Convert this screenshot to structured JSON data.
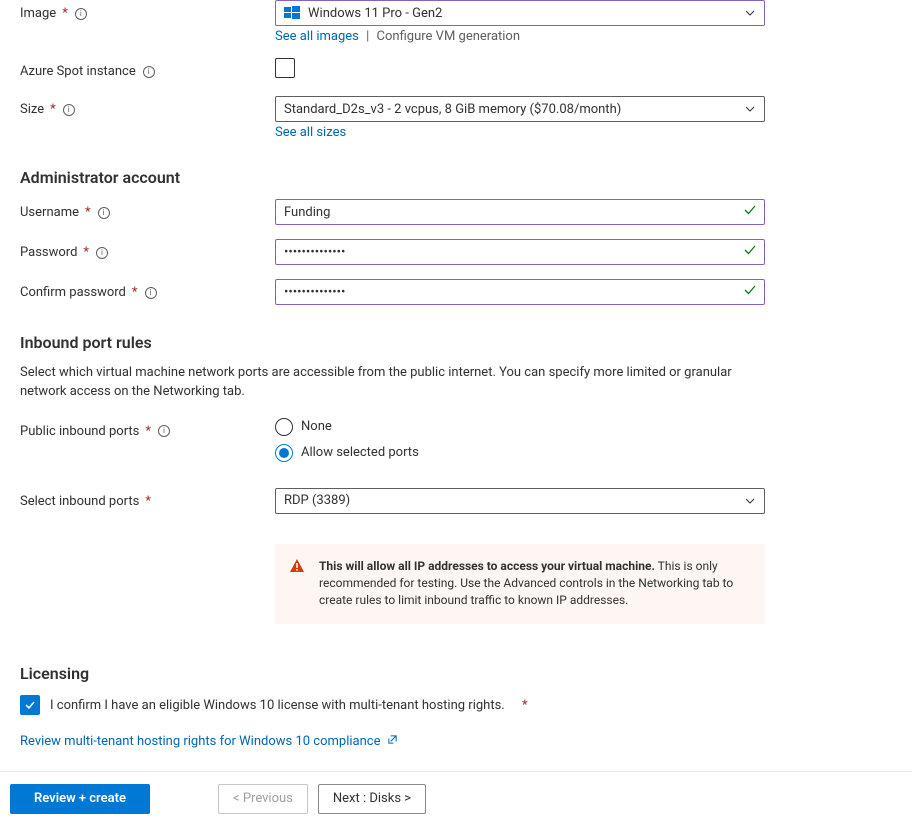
{
  "image": {
    "label": "Image",
    "value": "Windows 11 Pro - Gen2",
    "see_all": "See all images",
    "configure": "Configure VM generation"
  },
  "spot": {
    "label": "Azure Spot instance",
    "checked": false
  },
  "size": {
    "label": "Size",
    "value": "Standard_D2s_v3 - 2 vcpus, 8 GiB memory ($70.08/month)",
    "see_all": "See all sizes"
  },
  "admin": {
    "heading": "Administrator account",
    "username_label": "Username",
    "username_value": "Funding",
    "password_label": "Password",
    "password_value": "••••••••••••••",
    "confirm_label": "Confirm password",
    "confirm_value": "••••••••••••••"
  },
  "inbound": {
    "heading": "Inbound port rules",
    "desc": "Select which virtual machine network ports are accessible from the public internet. You can specify more limited or granular network access on the Networking tab.",
    "public_label": "Public inbound ports",
    "option_none": "None",
    "option_allow": "Allow selected ports",
    "select_label": "Select inbound ports",
    "select_value": "RDP (3389)",
    "warning_strong": "This will allow all IP addresses to access your virtual machine.",
    "warning_rest": " This is only recommended for testing.  Use the Advanced controls in the Networking tab to create rules to limit inbound traffic to known IP addresses."
  },
  "licensing": {
    "heading": "Licensing",
    "confirm_text": "I confirm I have an eligible Windows 10 license with multi-tenant hosting rights.",
    "checked": true,
    "review_link": "Review multi-tenant hosting rights for Windows 10 compliance"
  },
  "footer": {
    "review": "Review + create",
    "prev": "< Previous",
    "next": "Next : Disks >"
  }
}
